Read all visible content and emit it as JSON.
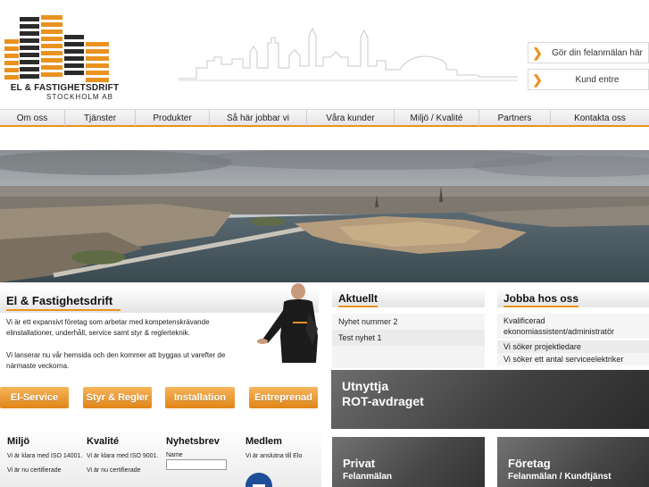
{
  "brand": {
    "name_line1": "EL & FASTIGHETSDRIFT",
    "name_line2": "STOCKHOLM AB",
    "accent": "#e9921f",
    "dark": "#222222"
  },
  "header_buttons": [
    {
      "label": "Gör din felanmälan här",
      "icon": "chevron-right-icon"
    },
    {
      "label": "Kund entre",
      "icon": "chevron-right-icon"
    }
  ],
  "nav": [
    "Om oss",
    "Tjänster",
    "Produkter",
    "Så här jobbar vi",
    "Våra kunder",
    "Miljö / Kvalité",
    "Partners",
    "Kontakta oss"
  ],
  "intro": {
    "title": "El & Fastighetsdrift",
    "p1": "Vi är ett expansivt företag som arbetar med kompetenskrävande elinstallationer, underhåll, service samt styr & reglerteknik.",
    "p2": "Vi lanserar nu vår hemsida och den kommer att byggas ut varefter de närmaste veckorna."
  },
  "service_buttons": [
    "El-Service",
    "Styr & Regler",
    "Installation",
    "Entreprenad"
  ],
  "bottom": {
    "miljo": {
      "title": "Miljö",
      "text": "Vi är klara med ISO 14001.",
      "more": "Vi är nu certifierade"
    },
    "kvalite": {
      "title": "Kvalité",
      "text": "Vi är klara med ISO 9001.",
      "more": "Vi är nu certifierade"
    },
    "nyhetsbrev": {
      "title": "Nyhetsbrev",
      "name_label": "Name"
    },
    "medlem": {
      "title": "Medlem",
      "text": "Vi är anslutna till Elo"
    }
  },
  "aktuellt": {
    "title": "Aktuellt",
    "items": [
      "Nyhet nummer 2",
      "Test nyhet 1"
    ]
  },
  "jobba": {
    "title": "Jobba hos oss",
    "items": [
      "Kvalificerad ekonomiassistent/administratör",
      "Vi söker projektledare",
      "Vi söker ett antal serviceelektriker"
    ]
  },
  "rot": {
    "line1": "Utnyttja",
    "line2": "ROT-avdraget"
  },
  "privat": {
    "title": "Privat",
    "sub": "Felanmälan"
  },
  "foretag": {
    "title": "Företag",
    "sub": "Felanmälan / Kundtjänst"
  }
}
